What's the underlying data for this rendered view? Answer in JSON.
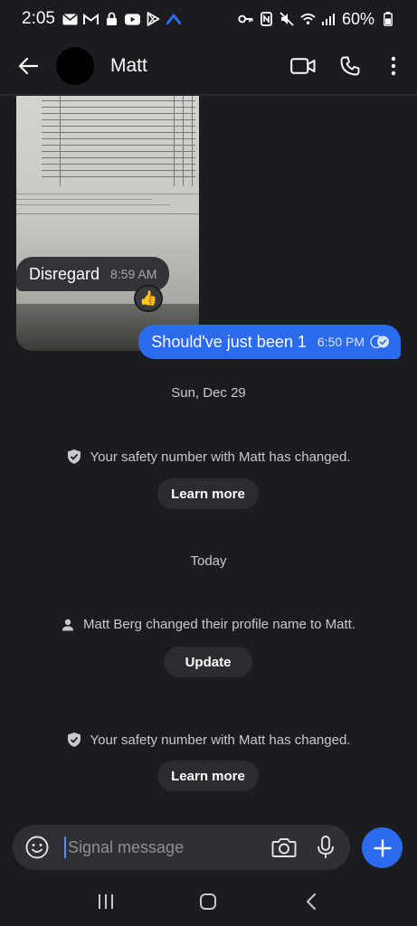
{
  "status_bar": {
    "time": "2:05",
    "battery": "60%",
    "icons_left": [
      "mail-icon",
      "gmail-icon",
      "lock-icon",
      "youtube-icon",
      "play-store-icon",
      "app-icon"
    ],
    "icons_right": [
      "vpn-key-icon",
      "nfc-icon",
      "mute-icon",
      "wifi-icon",
      "signal-icon",
      "battery-icon"
    ]
  },
  "header": {
    "contact_name": "Matt",
    "actions": [
      "video-call-icon",
      "voice-call-icon",
      "more-options-icon"
    ]
  },
  "messages": {
    "incoming": {
      "text": "Disregard",
      "time": "8:59 AM",
      "reaction": "👍"
    },
    "outgoing": {
      "text": "Should've just been 1",
      "time": "6:50 PM"
    }
  },
  "events": {
    "date_1": "Sun, Dec 29",
    "safety_1": "Your safety number with Matt has changed.",
    "learn_more_1": "Learn more",
    "date_2": "Today",
    "profile_change": "Matt Berg changed their profile name to Matt.",
    "update_label": "Update",
    "safety_2": "Your safety number with Matt has changed.",
    "learn_more_2": "Learn more"
  },
  "composer": {
    "placeholder": "Signal message"
  },
  "colors": {
    "accent": "#2c6bed",
    "background": "#1b1c1f",
    "incoming_bubble": "#333438"
  }
}
